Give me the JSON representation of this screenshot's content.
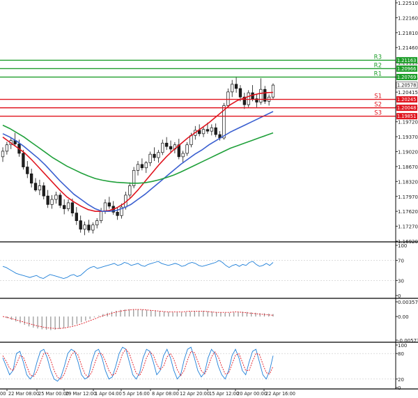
{
  "chart_data": [
    {
      "type": "candlestick",
      "panel": "price",
      "price_axis_labels": [
        "1.22510",
        "1.22160",
        "1.21810",
        "1.21460",
        "1.21115",
        "1.20765",
        "1.20415",
        "1.20065",
        "1.19720",
        "1.19370",
        "1.19020",
        "1.18670",
        "1.18320",
        "1.17970",
        "1.17620",
        "1.17270",
        "1.16920"
      ],
      "ylim": [
        1.1692,
        1.2251
      ],
      "levels": [
        {
          "name": "R3",
          "value": 1.21163,
          "label": "1.21163",
          "color": "#1e9e2a"
        },
        {
          "name": "R2",
          "value": 1.20966,
          "label": "1.20966",
          "color": "#1e9e2a"
        },
        {
          "name": "R1",
          "value": 1.20769,
          "label": "1.20769",
          "color": "#1e9e2a"
        },
        {
          "name": "S1",
          "value": 1.20245,
          "label": "1.20245",
          "color": "#e0141e"
        },
        {
          "name": "S2",
          "value": 1.20048,
          "label": "1.20048",
          "color": "#e0141e"
        },
        {
          "name": "S3",
          "value": 1.19851,
          "label": "1.19851",
          "color": "#e0141e"
        }
      ],
      "current_price": {
        "value": 1.20578,
        "label": "1.20578"
      },
      "ohlc": [
        [
          1.189,
          1.1912,
          1.1878,
          1.1903
        ],
        [
          1.1903,
          1.1925,
          1.1895,
          1.1918
        ],
        [
          1.1918,
          1.1935,
          1.1908,
          1.1928
        ],
        [
          1.1928,
          1.1946,
          1.1915,
          1.192
        ],
        [
          1.192,
          1.193,
          1.189,
          1.1898
        ],
        [
          1.1898,
          1.1906,
          1.186,
          1.1866
        ],
        [
          1.1866,
          1.188,
          1.184,
          1.185
        ],
        [
          1.185,
          1.1862,
          1.1818,
          1.1828
        ],
        [
          1.1828,
          1.184,
          1.1808,
          1.1812
        ],
        [
          1.1812,
          1.1836,
          1.18,
          1.1822
        ],
        [
          1.1822,
          1.183,
          1.179,
          1.1798
        ],
        [
          1.1798,
          1.1812,
          1.177,
          1.1778
        ],
        [
          1.1778,
          1.18,
          1.1768,
          1.179
        ],
        [
          1.179,
          1.1808,
          1.178,
          1.18
        ],
        [
          1.18,
          1.1806,
          1.177,
          1.1776
        ],
        [
          1.1776,
          1.179,
          1.1755,
          1.1768
        ],
        [
          1.1768,
          1.179,
          1.1762,
          1.1782
        ],
        [
          1.1782,
          1.1792,
          1.175,
          1.1758
        ],
        [
          1.1758,
          1.1772,
          1.173,
          1.174
        ],
        [
          1.174,
          1.1752,
          1.1712,
          1.172
        ],
        [
          1.172,
          1.1738,
          1.1706,
          1.173
        ],
        [
          1.173,
          1.1742,
          1.1712,
          1.1718
        ],
        [
          1.1718,
          1.1736,
          1.171,
          1.173
        ],
        [
          1.173,
          1.1746,
          1.1722,
          1.174
        ],
        [
          1.174,
          1.177,
          1.1734,
          1.1762
        ],
        [
          1.1762,
          1.179,
          1.1756,
          1.1782
        ],
        [
          1.1782,
          1.1796,
          1.1768,
          1.1774
        ],
        [
          1.1774,
          1.1786,
          1.1754,
          1.176
        ],
        [
          1.176,
          1.177,
          1.1742,
          1.1752
        ],
        [
          1.1752,
          1.178,
          1.1745,
          1.1772
        ],
        [
          1.1772,
          1.1808,
          1.1766,
          1.18
        ],
        [
          1.18,
          1.183,
          1.1794,
          1.1822
        ],
        [
          1.1822,
          1.1866,
          1.1816,
          1.1858
        ],
        [
          1.1858,
          1.188,
          1.1846,
          1.1872
        ],
        [
          1.1872,
          1.1886,
          1.1858,
          1.1864
        ],
        [
          1.1864,
          1.188,
          1.1852,
          1.1876
        ],
        [
          1.1876,
          1.1902,
          1.1868,
          1.1896
        ],
        [
          1.1896,
          1.1912,
          1.188,
          1.1888
        ],
        [
          1.1888,
          1.1906,
          1.1876,
          1.19
        ],
        [
          1.19,
          1.193,
          1.1894,
          1.1922
        ],
        [
          1.1922,
          1.1936,
          1.1906,
          1.1914
        ],
        [
          1.1914,
          1.1928,
          1.19,
          1.1908
        ],
        [
          1.1908,
          1.1924,
          1.1898,
          1.1918
        ],
        [
          1.1918,
          1.1932,
          1.1884,
          1.189
        ],
        [
          1.189,
          1.1904,
          1.1876,
          1.1898
        ],
        [
          1.1898,
          1.1924,
          1.1892,
          1.1918
        ],
        [
          1.1918,
          1.1946,
          1.1912,
          1.194
        ],
        [
          1.194,
          1.1962,
          1.193,
          1.1952
        ],
        [
          1.1952,
          1.1966,
          1.1938,
          1.1944
        ],
        [
          1.1944,
          1.196,
          1.1936,
          1.1954
        ],
        [
          1.1954,
          1.197,
          1.1944,
          1.195
        ],
        [
          1.195,
          1.1966,
          1.194,
          1.1958
        ],
        [
          1.1958,
          1.1968,
          1.1936,
          1.1942
        ],
        [
          1.1942,
          1.195,
          1.1928,
          1.1934
        ],
        [
          1.1934,
          1.2016,
          1.193,
          1.201
        ],
        [
          1.201,
          1.205,
          1.2004,
          1.2042
        ],
        [
          1.2042,
          1.207,
          1.203,
          1.206
        ],
        [
          1.206,
          1.2078,
          1.204,
          1.205
        ],
        [
          1.205,
          1.2058,
          1.202,
          1.203
        ],
        [
          1.203,
          1.204,
          1.2002,
          1.2012
        ],
        [
          1.2012,
          1.2046,
          1.2006,
          1.204
        ],
        [
          1.204,
          1.2058,
          1.202,
          1.2026
        ],
        [
          1.2026,
          1.2036,
          1.2006,
          1.2018
        ],
        [
          1.2018,
          1.2074,
          1.2012,
          1.2048
        ],
        [
          1.2048,
          1.2056,
          1.2014,
          1.202
        ],
        [
          1.202,
          1.2036,
          1.201,
          1.203
        ],
        [
          1.203,
          1.2062,
          1.2024,
          1.2058
        ]
      ],
      "moving_averages": [
        {
          "color": "#e0141e",
          "values": [
            1.1936,
            1.1924,
            1.1912,
            1.19,
            1.1884,
            1.1866,
            1.1848,
            1.183,
            1.1812,
            1.1796,
            1.1784,
            1.1774,
            1.1766,
            1.1762,
            1.1762,
            1.1764,
            1.177,
            1.178,
            1.1794,
            1.1812,
            1.1832,
            1.1852,
            1.1872,
            1.189,
            1.1906,
            1.192,
            1.1934,
            1.1946,
            1.1958,
            1.197,
            1.1984,
            1.1998,
            1.2012,
            1.2022,
            1.2028,
            1.2034,
            1.2038,
            1.204,
            1.2041
          ]
        },
        {
          "color": "#3a5fd0",
          "values": [
            1.1944,
            1.1936,
            1.1926,
            1.1914,
            1.19,
            1.1886,
            1.187,
            1.1852,
            1.1834,
            1.1818,
            1.1802,
            1.179,
            1.1778,
            1.1768,
            1.1762,
            1.1762,
            1.1764,
            1.177,
            1.1778,
            1.179,
            1.1802,
            1.1816,
            1.183,
            1.1844,
            1.1858,
            1.1872,
            1.1884,
            1.1896,
            1.1906,
            1.1918,
            1.1928,
            1.1938,
            1.1948,
            1.1956,
            1.1964,
            1.1972,
            1.198,
            1.1988,
            1.1996
          ]
        },
        {
          "color": "#1fa03a",
          "values": [
            1.1964,
            1.1956,
            1.1946,
            1.1936,
            1.1924,
            1.1912,
            1.19,
            1.1888,
            1.1878,
            1.1868,
            1.186,
            1.1852,
            1.1845,
            1.1839,
            1.1835,
            1.1832,
            1.183,
            1.1829,
            1.1828,
            1.1828,
            1.1829,
            1.1832,
            1.1836,
            1.1841,
            1.1847,
            1.1854,
            1.1862,
            1.187,
            1.1878,
            1.1886,
            1.1894,
            1.1902,
            1.191,
            1.1916,
            1.1922,
            1.1928,
            1.1934,
            1.194,
            1.1946
          ]
        }
      ]
    },
    {
      "type": "line",
      "panel": "rsi",
      "axis_labels": [
        "100",
        "70",
        "30",
        "0"
      ],
      "ylim": [
        0,
        100
      ],
      "values": [
        58,
        56,
        52,
        48,
        44,
        42,
        40,
        38,
        36,
        38,
        40,
        36,
        34,
        38,
        42,
        40,
        38,
        36,
        34,
        36,
        40,
        42,
        38,
        40,
        46,
        52,
        56,
        58,
        54,
        56,
        58,
        60,
        62,
        64,
        60,
        62,
        66,
        64,
        60,
        62,
        64,
        60,
        58,
        62,
        64,
        66,
        68,
        64,
        62,
        60,
        62,
        64,
        62,
        58,
        60,
        64,
        66,
        64,
        60,
        58,
        60,
        62,
        64,
        66,
        70,
        66,
        60,
        56,
        60,
        62,
        58,
        62,
        60,
        66,
        68,
        62,
        58,
        60,
        64,
        60,
        66
      ]
    },
    {
      "type": "bar",
      "panel": "macd",
      "axis_labels": [
        "0.003575",
        "0.00",
        "-0.005737"
      ],
      "ylim": [
        -0.005737,
        0.003575
      ],
      "values": [
        0.0,
        -0.0004,
        -0.0008,
        -0.0012,
        -0.0016,
        -0.002,
        -0.0024,
        -0.0027,
        -0.0029,
        -0.0031,
        -0.0032,
        -0.0033,
        -0.0032,
        -0.003,
        -0.0028,
        -0.0025,
        -0.0022,
        -0.0018,
        -0.0014,
        -0.001,
        -0.0006,
        -0.0002,
        0.0002,
        0.0006,
        0.0009,
        0.0012,
        0.0014,
        0.0016,
        0.0017,
        0.0018,
        0.0018,
        0.0018,
        0.0017,
        0.0016,
        0.0015,
        0.0014,
        0.0013,
        0.0012,
        0.0011,
        0.001,
        0.001,
        0.001,
        0.0011,
        0.0012,
        0.0013,
        0.0014,
        0.0014,
        0.0013,
        0.0012,
        0.0011,
        0.001,
        0.0009,
        0.0009,
        0.001,
        0.0011,
        0.0012,
        0.0011,
        0.001,
        0.0009,
        0.0008,
        0.0008,
        0.0007,
        0.0006
      ],
      "signal": [
        0.0,
        -0.0002,
        -0.0005,
        -0.0008,
        -0.0011,
        -0.0014,
        -0.0017,
        -0.002,
        -0.0023,
        -0.0025,
        -0.0027,
        -0.0028,
        -0.0029,
        -0.0029,
        -0.0028,
        -0.0026,
        -0.0024,
        -0.0021,
        -0.0018,
        -0.0014,
        -0.001,
        -0.0006,
        -0.0002,
        0.0002,
        0.0005,
        0.0008,
        0.0011,
        0.0013,
        0.0015,
        0.0016,
        0.0017,
        0.0017,
        0.0017,
        0.0016,
        0.0015,
        0.0014,
        0.0013,
        0.0012,
        0.0011,
        0.0011,
        0.0011,
        0.0011,
        0.0012,
        0.0013,
        0.0013,
        0.0013,
        0.0013,
        0.0012,
        0.0011,
        0.001,
        0.001,
        0.001,
        0.001,
        0.0011,
        0.0011,
        0.001,
        0.0009,
        0.0008,
        0.0007,
        0.0006,
        0.0005,
        0.0004,
        0.0003
      ]
    },
    {
      "type": "line",
      "panel": "stochastic",
      "axis_labels": [
        "100",
        "80",
        "20",
        "0"
      ],
      "ylim": [
        0,
        100
      ],
      "main": [
        70,
        50,
        30,
        40,
        80,
        85,
        60,
        30,
        20,
        30,
        60,
        85,
        90,
        70,
        40,
        20,
        15,
        25,
        50,
        80,
        90,
        85,
        60,
        30,
        20,
        25,
        60,
        85,
        90,
        70,
        40,
        20,
        25,
        50,
        80,
        95,
        90,
        60,
        30,
        20,
        35,
        70,
        90,
        85,
        60,
        30,
        40,
        75,
        90,
        70,
        40,
        20,
        30,
        65,
        90,
        95,
        70,
        40,
        25,
        35,
        70,
        90,
        80,
        50,
        30,
        20,
        40,
        75,
        90,
        70,
        40,
        30,
        60,
        85,
        90,
        60,
        30,
        20,
        40,
        75
      ],
      "signal": [
        75,
        62,
        45,
        40,
        55,
        75,
        72,
        50,
        30,
        26,
        38,
        60,
        80,
        82,
        65,
        40,
        24,
        20,
        32,
        55,
        76,
        85,
        76,
        52,
        32,
        24,
        36,
        60,
        80,
        80,
        62,
        40,
        28,
        34,
        55,
        80,
        90,
        80,
        56,
        34,
        28,
        45,
        70,
        84,
        76,
        55,
        42,
        50,
        72,
        80,
        66,
        42,
        28,
        40,
        65,
        85,
        82,
        62,
        40,
        32,
        48,
        72,
        84,
        72,
        50,
        32,
        34,
        55,
        76,
        80,
        60,
        40,
        40,
        62,
        80,
        78,
        55,
        35,
        32,
        50
      ]
    }
  ],
  "x_axis_labels": [
    "22 Mar 08:00",
    "25 Mar 00:00",
    "29 Mar 12:00",
    "1 Apr 04:00",
    "5 Apr 16:00",
    "8 Apr 08:00",
    "12 Apr 20:00",
    "15 Apr 12:00",
    "20 Apr 00:00",
    "22 Apr 16:00"
  ],
  "x_axis_partial_left": "00",
  "colors": {
    "up": "#1f1f1f",
    "down": "#1f1f1f",
    "grid_divider": "#000000",
    "axis_text": "#222222",
    "rsi": "#1e7fd8",
    "macd": "#9a9a9a",
    "macd_signal": "#e0141e",
    "stoch_main": "#1e7fd8",
    "stoch_signal": "#e0141e"
  }
}
